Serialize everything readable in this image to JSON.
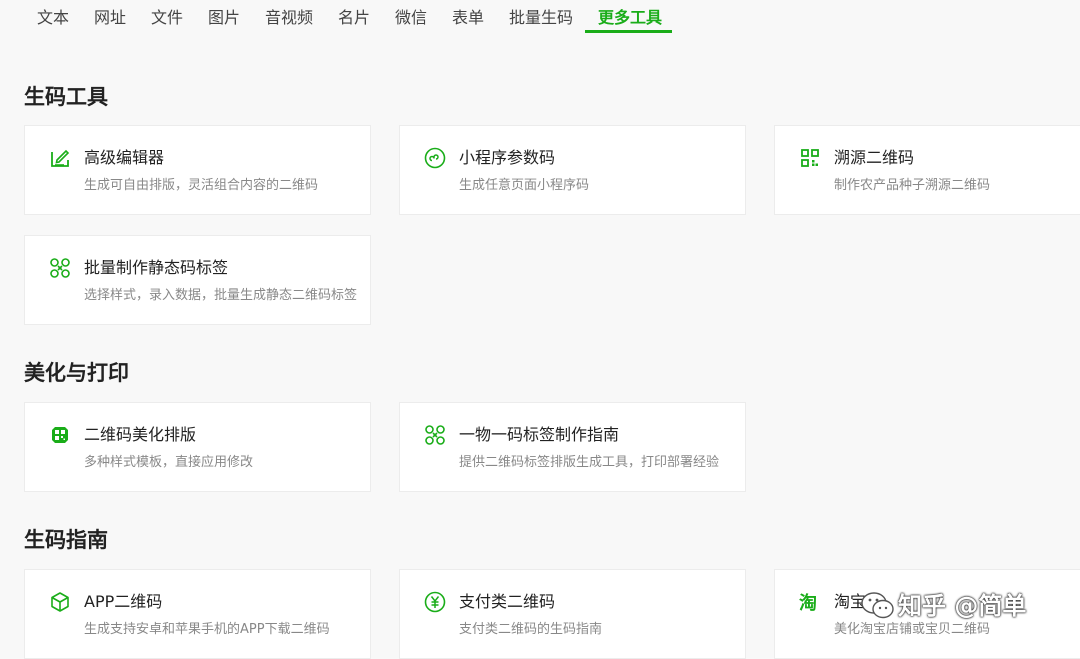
{
  "tabs": {
    "items": [
      {
        "label": "文本"
      },
      {
        "label": "网址"
      },
      {
        "label": "文件"
      },
      {
        "label": "图片"
      },
      {
        "label": "音视频"
      },
      {
        "label": "名片"
      },
      {
        "label": "微信"
      },
      {
        "label": "表单"
      },
      {
        "label": "批量生码"
      },
      {
        "label": "更多工具"
      }
    ],
    "active_index": 9
  },
  "sections": [
    {
      "title": "生码工具",
      "cards": [
        {
          "icon": "edit-icon",
          "title": "高级编辑器",
          "desc": "生成可自由排版，灵活组合内容的二维码"
        },
        {
          "icon": "mini-program-icon",
          "title": "小程序参数码",
          "desc": "生成任意页面小程序码"
        },
        {
          "icon": "qr-grid-icon",
          "title": "溯源二维码",
          "desc": "制作农产品种子溯源二维码"
        },
        {
          "icon": "batch-label-icon",
          "title": "批量制作静态码标签",
          "desc": "选择样式，录入数据，批量生成静态二维码标签"
        }
      ]
    },
    {
      "title": "美化与打印",
      "cards": [
        {
          "icon": "beautify-qr-icon",
          "title": "二维码美化排版",
          "desc": "多种样式模板，直接应用修改"
        },
        {
          "icon": "batch-label-icon",
          "title": "一物一码标签制作指南",
          "desc": "提供二维码标签排版生成工具，打印部署经验"
        }
      ]
    },
    {
      "title": "生码指南",
      "cards": [
        {
          "icon": "app-box-icon",
          "title": "APP二维码",
          "desc": "生成支持安卓和苹果手机的APP下载二维码"
        },
        {
          "icon": "yuan-payment-icon",
          "title": "支付类二维码",
          "desc": "支付类二维码的生码指南"
        },
        {
          "icon": "taobao-icon",
          "title": "淘宝",
          "desc": "美化淘宝店铺或宝贝二维码"
        }
      ]
    }
  ],
  "watermark": {
    "text": "知乎 @简单"
  },
  "colors": {
    "accent": "#1aad19",
    "card_bg": "#ffffff",
    "page_bg": "#f8f8f8"
  }
}
